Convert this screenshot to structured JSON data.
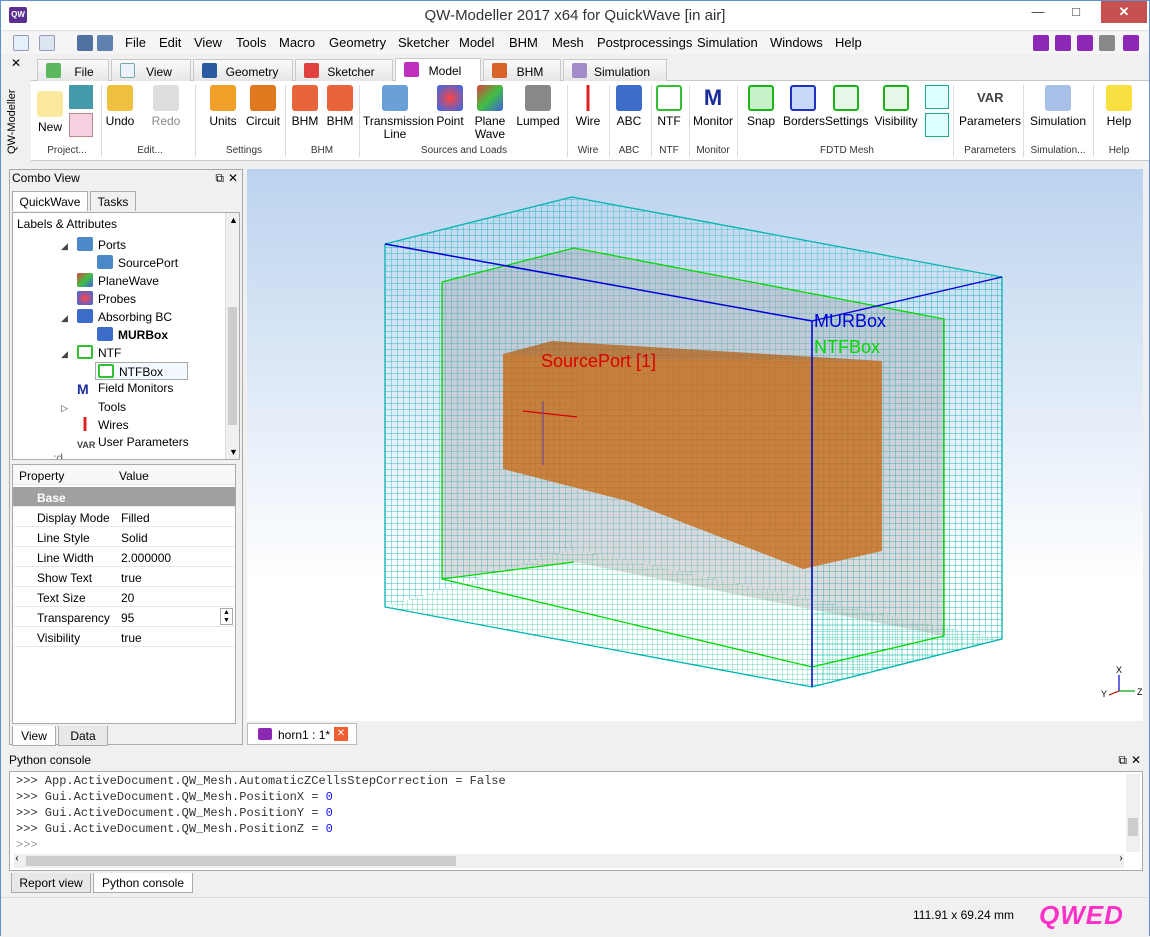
{
  "window": {
    "title": "QW-Modeller 2017 x64 for QuickWave [in air]"
  },
  "menu": [
    "File",
    "Edit",
    "View",
    "Tools",
    "Macro",
    "Geometry",
    "Sketcher",
    "Model",
    "BHM",
    "Mesh",
    "Postprocessings",
    "Simulation",
    "Windows",
    "Help"
  ],
  "ribbon_tabs": [
    "File",
    "View",
    "Geometry",
    "Sketcher",
    "Model",
    "BHM",
    "Simulation"
  ],
  "sidebar_label": "QW-Modeller",
  "ribbon": {
    "new": "New",
    "project_grp": "Project...",
    "undo": "Undo",
    "redo": "Redo",
    "edit_grp": "Edit...",
    "units": "Units",
    "circuit": "Circuit",
    "settings_grp": "Settings",
    "bhm1": "BHM",
    "bhm2": "BHM",
    "bhm_grp": "BHM",
    "tl1": "Transmission",
    "tl2": "Line",
    "point": "Point",
    "pw1": "Plane",
    "pw2": "Wave",
    "lumped": "Lumped",
    "sources_grp": "Sources and Loads",
    "wire": "Wire",
    "wire_grp": "Wire",
    "abc": "ABC",
    "abc_grp": "ABC",
    "ntf": "NTF",
    "ntf_grp": "NTF",
    "monitor": "Monitor",
    "monitor_grp": "Monitor",
    "snap": "Snap",
    "borders": "Borders",
    "settings": "Settings",
    "visibility": "Visibility",
    "fdtd_grp": "FDTD Mesh",
    "var": "VAR",
    "parameters": "Parameters",
    "parameters_grp": "Parameters",
    "simulation": "Simulation",
    "simulation_grp": "Simulation...",
    "help": "Help",
    "help_grp": "Help"
  },
  "combo": {
    "title": "Combo View",
    "tabs": [
      "QuickWave",
      "Tasks"
    ],
    "tree_header": "Labels & Attributes",
    "tree": [
      "Ports",
      "SourcePort",
      "PlaneWave",
      "Probes",
      "Absorbing BC",
      "MURBox",
      "NTF",
      "NTFBox",
      "Field Monitors",
      "Tools",
      "Wires",
      "User Parameters"
    ],
    "tree_partial": "...:d",
    "props_headers": [
      "Property",
      "Value"
    ],
    "props_group": "Base",
    "props": [
      {
        "k": "Display Mode",
        "v": "Filled"
      },
      {
        "k": "Line Style",
        "v": "Solid"
      },
      {
        "k": "Line Width",
        "v": "2.000000"
      },
      {
        "k": "Show Text",
        "v": "true"
      },
      {
        "k": "Text Size",
        "v": "20"
      },
      {
        "k": "Transparency",
        "v": "95"
      },
      {
        "k": "Visibility",
        "v": "true"
      }
    ],
    "bottom_tabs": [
      "View",
      "Data"
    ]
  },
  "view3d": {
    "labels": {
      "murbox": "MURBox",
      "ntfbox": "NTFBox",
      "sourceport": "SourcePort [1]"
    },
    "axes": {
      "x": "X",
      "y": "Y",
      "z": "Z"
    }
  },
  "doc_tab": "horn1 : 1*",
  "python": {
    "title": "Python console",
    "lines": [
      {
        "code": ">>> App.ActiveDocument.QW_Mesh.AutomaticZCellsStepCorrection = False",
        "num": ""
      },
      {
        "code": ">>> Gui.ActiveDocument.QW_Mesh.PositionX = ",
        "num": "0"
      },
      {
        "code": ">>> Gui.ActiveDocument.QW_Mesh.PositionY = ",
        "num": "0"
      },
      {
        "code": ">>> Gui.ActiveDocument.QW_Mesh.PositionZ = ",
        "num": "0"
      },
      {
        "code": ">>> ",
        "num": ""
      }
    ]
  },
  "bottom_tabs": [
    "Report view",
    "Python console"
  ],
  "status": {
    "dims": "111.91 x 69.24 mm",
    "logo": "QWED"
  },
  "colors": {
    "mur": "#0000d8",
    "ntf": "#00d800",
    "source": "#d80000",
    "mesh": "#00b4b4",
    "horn": "#c8640a"
  }
}
